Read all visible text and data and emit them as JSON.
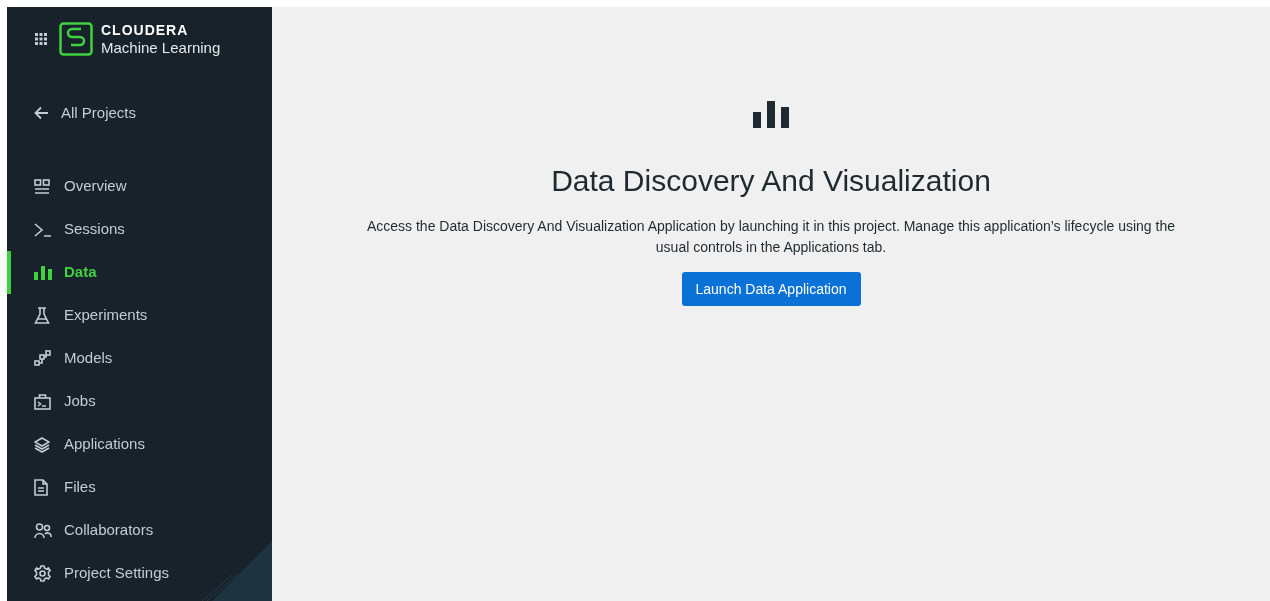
{
  "brand": {
    "name": "CLOUDERA",
    "product": "Machine Learning"
  },
  "back_link": {
    "label": "All Projects"
  },
  "sidebar": {
    "items": [
      {
        "kind": "overview",
        "label": "Overview",
        "selected": false
      },
      {
        "kind": "sessions",
        "label": "Sessions",
        "selected": false
      },
      {
        "kind": "data",
        "label": "Data",
        "selected": true
      },
      {
        "kind": "experiments",
        "label": "Experiments",
        "selected": false
      },
      {
        "kind": "models",
        "label": "Models",
        "selected": false
      },
      {
        "kind": "jobs",
        "label": "Jobs",
        "selected": false
      },
      {
        "kind": "applications",
        "label": "Applications",
        "selected": false
      },
      {
        "kind": "files",
        "label": "Files",
        "selected": false
      },
      {
        "kind": "collaborators",
        "label": "Collaborators",
        "selected": false
      },
      {
        "kind": "settings",
        "label": "Project Settings",
        "selected": false
      }
    ]
  },
  "main": {
    "title": "Data Discovery And Visualization",
    "description": "Access the Data Discovery And Visualization Application by launching it in this project. Manage this application’s lifecycle using the usual controls in the Applications tab.",
    "button": "Launch Data Application"
  }
}
